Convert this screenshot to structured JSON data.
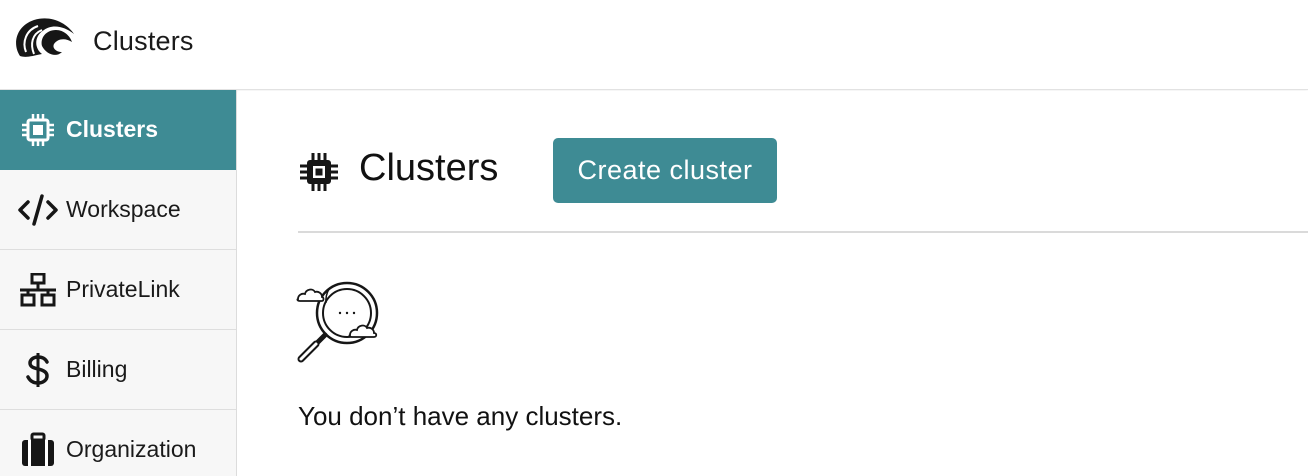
{
  "header": {
    "title": "Clusters",
    "logo_icon": "wave-logo-icon"
  },
  "sidebar": {
    "items": [
      {
        "label": "Clusters",
        "icon": "chip-icon",
        "active": true
      },
      {
        "label": "Workspace",
        "icon": "code-icon",
        "active": false
      },
      {
        "label": "PrivateLink",
        "icon": "network-icon",
        "active": false
      },
      {
        "label": "Billing",
        "icon": "dollar-icon",
        "active": false
      },
      {
        "label": "Organization",
        "icon": "briefcase-icon",
        "active": false
      }
    ]
  },
  "main": {
    "title": "Clusters",
    "title_icon": "chip-icon",
    "create_button_label": "Create cluster",
    "empty_state_icon": "magnifier-clouds-icon",
    "empty_message": "You don’t have any clusters."
  },
  "colors": {
    "accent": "#3e8b94",
    "sidebar_bg": "#f7f7f7"
  }
}
